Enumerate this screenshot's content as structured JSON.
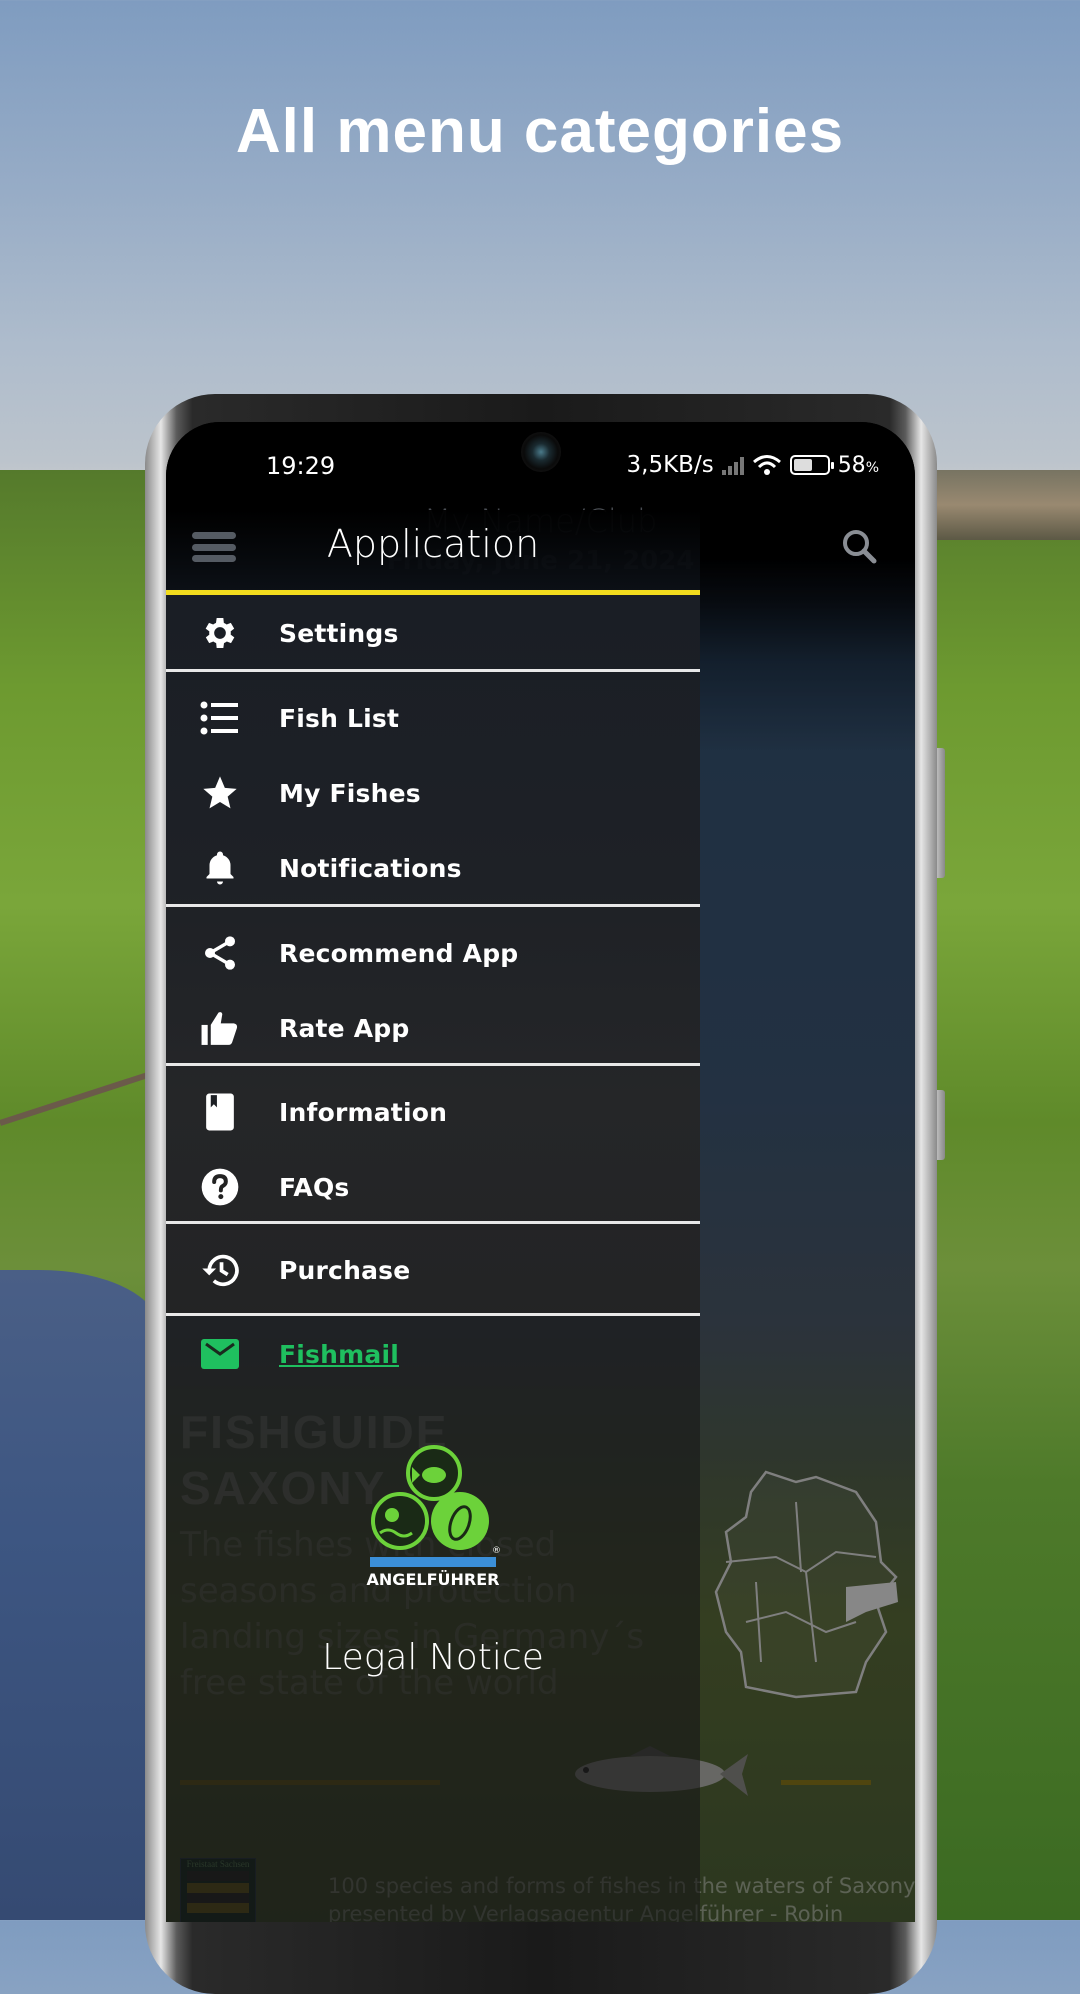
{
  "promo": {
    "title": "All menu categories"
  },
  "status_bar": {
    "time": "19:29",
    "network_speed": "3,5KB/s",
    "battery_percent": "58",
    "battery_unit": "%",
    "battery_level": 0.58
  },
  "app_bar": {
    "menu_icon": "hamburger-icon",
    "search_icon": "search-icon",
    "name_club": "My Name/Club",
    "date": "Friday, June 21, 2024"
  },
  "drawer": {
    "title": "Application",
    "accent_color": "#f2dc1e",
    "link_color": "#1fbf5f",
    "groups": [
      {
        "items": [
          {
            "label": "Settings",
            "icon": "gear-icon"
          }
        ]
      },
      {
        "items": [
          {
            "label": "Fish List",
            "icon": "list-icon"
          },
          {
            "label": "My Fishes",
            "icon": "star-icon"
          },
          {
            "label": "Notifications",
            "icon": "bell-icon"
          }
        ]
      },
      {
        "items": [
          {
            "label": "Recommend App",
            "icon": "share-icon"
          },
          {
            "label": "Rate App",
            "icon": "thumbs-up-icon"
          }
        ]
      },
      {
        "items": [
          {
            "label": "Information",
            "icon": "book-icon"
          },
          {
            "label": "FAQs",
            "icon": "help-icon"
          }
        ]
      },
      {
        "items": [
          {
            "label": "Purchase",
            "icon": "history-icon"
          }
        ]
      },
      {
        "items": [
          {
            "label": "Fishmail",
            "icon": "mail-icon"
          }
        ]
      }
    ],
    "logo_text": "ANGELFÜHRER",
    "logo_reg": "®",
    "legal_notice": "Legal Notice"
  },
  "home": {
    "title_line1": "FISHGUIDE",
    "title_line2": "SAXONY",
    "description": [
      "The fishes with closed",
      "seasons and protection",
      "landing sizes in Germany´s",
      "free state of the world"
    ],
    "coat_label": "Freistaat Sachsen",
    "footer_line1": "100 species and forms of fishes in the waters of Saxony",
    "footer_line2": "presented by Verlagsagentur Angelführer - Robin"
  }
}
